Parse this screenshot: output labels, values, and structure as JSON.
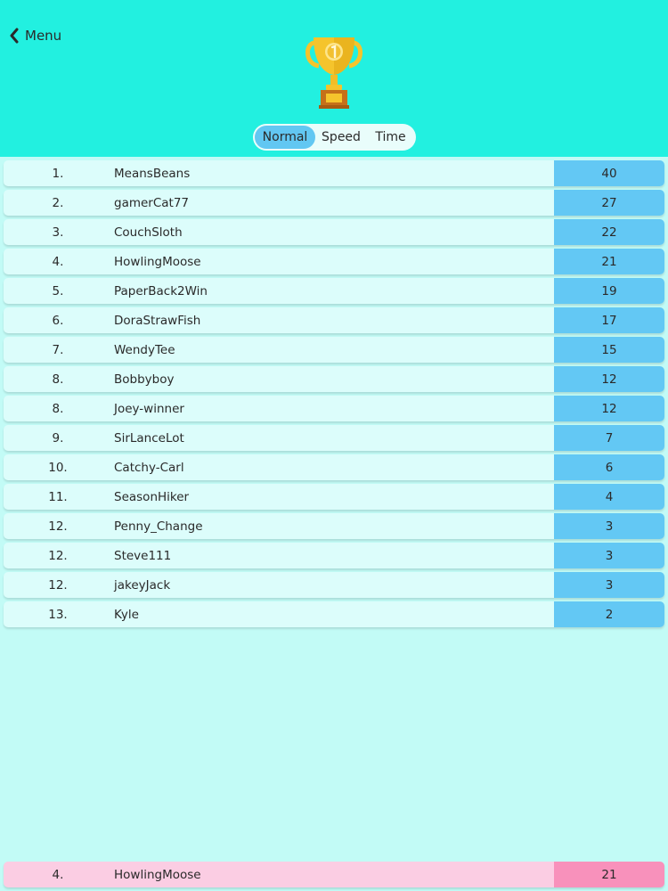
{
  "header": {
    "back_label": "Menu"
  },
  "tabs": [
    {
      "label": "Normal",
      "active": true
    },
    {
      "label": "Speed",
      "active": false
    },
    {
      "label": "Time",
      "active": false
    }
  ],
  "leaderboard": [
    {
      "rank": "1.",
      "name": "MeansBeans",
      "score": "40"
    },
    {
      "rank": "2.",
      "name": "gamerCat77",
      "score": "27"
    },
    {
      "rank": "3.",
      "name": "CouchSloth",
      "score": "22"
    },
    {
      "rank": "4.",
      "name": "HowlingMoose",
      "score": "21"
    },
    {
      "rank": "5.",
      "name": "PaperBack2Win",
      "score": "19"
    },
    {
      "rank": "6.",
      "name": "DoraStrawFish",
      "score": "17"
    },
    {
      "rank": "7.",
      "name": "WendyTee",
      "score": "15"
    },
    {
      "rank": "8.",
      "name": "Bobbyboy",
      "score": "12"
    },
    {
      "rank": "8.",
      "name": "Joey-winner",
      "score": "12"
    },
    {
      "rank": "9.",
      "name": "SirLanceLot",
      "score": "7"
    },
    {
      "rank": "10.",
      "name": "Catchy-Carl",
      "score": "6"
    },
    {
      "rank": "11.",
      "name": "SeasonHiker",
      "score": "4"
    },
    {
      "rank": "12.",
      "name": "Penny_Change",
      "score": "3"
    },
    {
      "rank": "12.",
      "name": "Steve111",
      "score": "3"
    },
    {
      "rank": "12.",
      "name": "jakeyJack",
      "score": "3"
    },
    {
      "rank": "13.",
      "name": "Kyle",
      "score": "2"
    }
  ],
  "current_player": {
    "rank": "4.",
    "name": "HowlingMoose",
    "score": "21"
  },
  "icons": {
    "back": "chevron-left-icon",
    "trophy": "trophy-icon"
  },
  "colors": {
    "header_bg": "#22f0e0",
    "page_bg": "#c2fbf6",
    "row_bg": "#dcfdfb",
    "score_bg": "#63c8f4",
    "active_tab": "#62c7f2",
    "me_row_bg": "#fbcde3",
    "me_score_bg": "#f891bb",
    "trophy_gold": "#f5c42c"
  }
}
